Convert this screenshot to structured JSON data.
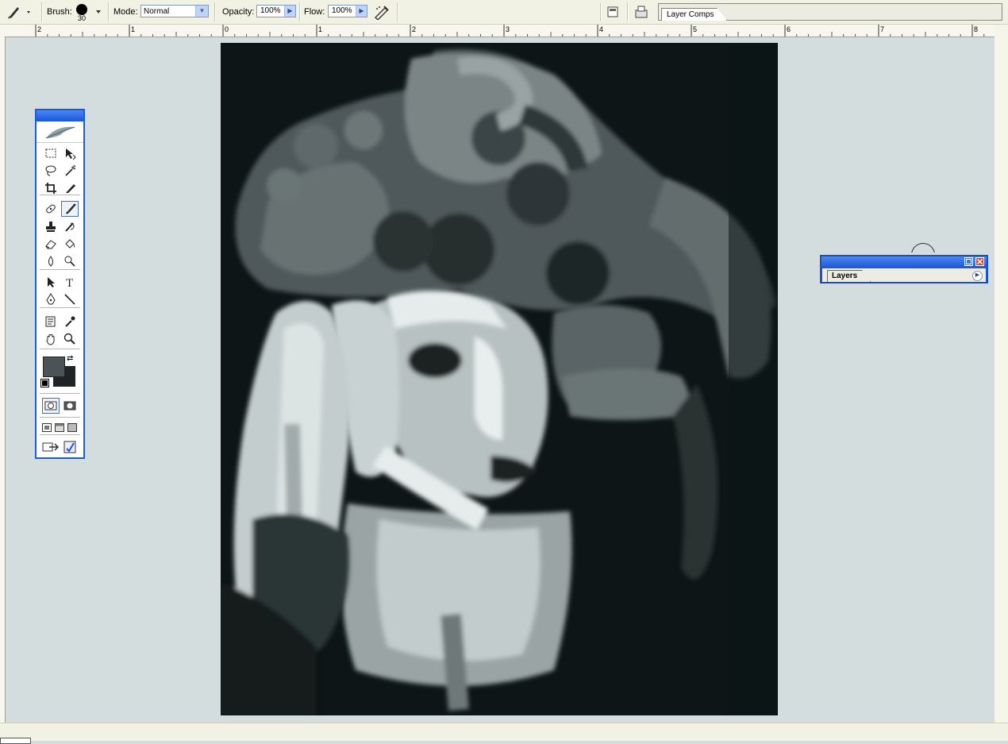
{
  "options_bar": {
    "brush_label": "Brush:",
    "brush_size": "30",
    "mode_label": "Mode:",
    "mode_value": "Normal",
    "opacity_label": "Opacity:",
    "opacity_value": "100%",
    "flow_label": "Flow:",
    "flow_value": "100%",
    "layer_comps_tab": "Layer Comps"
  },
  "ruler": {
    "labels": [
      "2",
      "1",
      "0",
      "1",
      "2",
      "3",
      "4",
      "5",
      "6",
      "7",
      "8"
    ]
  },
  "toolbox": {
    "tools": [
      "marquee-tool",
      "move-tool",
      "lasso-tool",
      "magic-wand-tool",
      "crop-tool",
      "slice-tool",
      "healing-brush-tool",
      "brush-tool",
      "clone-stamp-tool",
      "history-brush-tool",
      "eraser-tool",
      "paint-bucket-tool",
      "blur-tool",
      "dodge-tool",
      "path-selection-tool",
      "type-tool",
      "pen-tool",
      "line-tool",
      "notes-tool",
      "eyedropper-tool",
      "hand-tool",
      "zoom-tool"
    ],
    "foreground_color": "#4a5355",
    "background_color": "#1f2526"
  },
  "layers_palette": {
    "tab_label": "Layers"
  },
  "colors": {
    "workspace": "#d3dddd",
    "options_bar": "#f2f2e4",
    "xp_blue": "#1a5be0",
    "canvas_bg": "#0d1516"
  }
}
